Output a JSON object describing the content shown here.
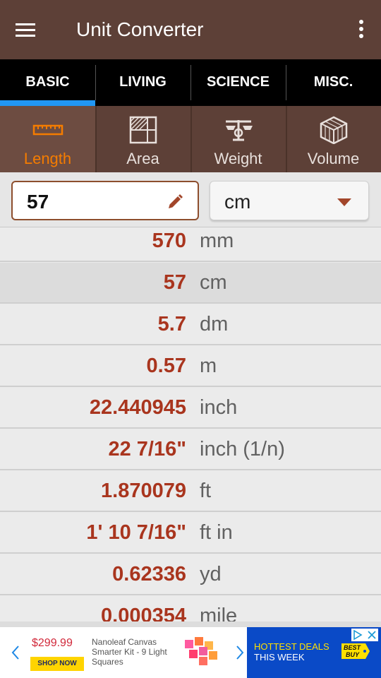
{
  "app": {
    "title": "Unit Converter"
  },
  "tabs": [
    {
      "label": "BASIC"
    },
    {
      "label": "LIVING"
    },
    {
      "label": "SCIENCE"
    },
    {
      "label": "MISC."
    }
  ],
  "categories": [
    {
      "label": "Length",
      "icon": "ruler-icon"
    },
    {
      "label": "Area",
      "icon": "area-grid-icon"
    },
    {
      "label": "Weight",
      "icon": "scale-icon"
    },
    {
      "label": "Volume",
      "icon": "cube-icon"
    }
  ],
  "input": {
    "value": "57",
    "unit": "cm"
  },
  "results": [
    {
      "value": "570",
      "unit": "mm"
    },
    {
      "value": "57",
      "unit": "cm"
    },
    {
      "value": "5.7",
      "unit": "dm"
    },
    {
      "value": "0.57",
      "unit": "m"
    },
    {
      "value": "22.440945",
      "unit": "inch"
    },
    {
      "value": "22 7/16\"",
      "unit": "inch (1/n)"
    },
    {
      "value": "1.870079",
      "unit": "ft"
    },
    {
      "value": "1' 10 7/16\"",
      "unit": "ft in"
    },
    {
      "value": "0.62336",
      "unit": "yd"
    },
    {
      "value": "0.000354",
      "unit": "mile"
    }
  ],
  "ad": {
    "price": "$299.99",
    "shop_label": "SHOP NOW",
    "product": "Nanoleaf Canvas Smarter Kit - 9 Light Squares",
    "deal_line1": "HOTTEST DEALS",
    "deal_line2": "THIS WEEK",
    "brand": "BEST BUY"
  },
  "colors": {
    "appbar": "#5d4037",
    "tab_indicator": "#2196f3",
    "active_category": "#f57c00",
    "result_value": "#a9351e"
  }
}
